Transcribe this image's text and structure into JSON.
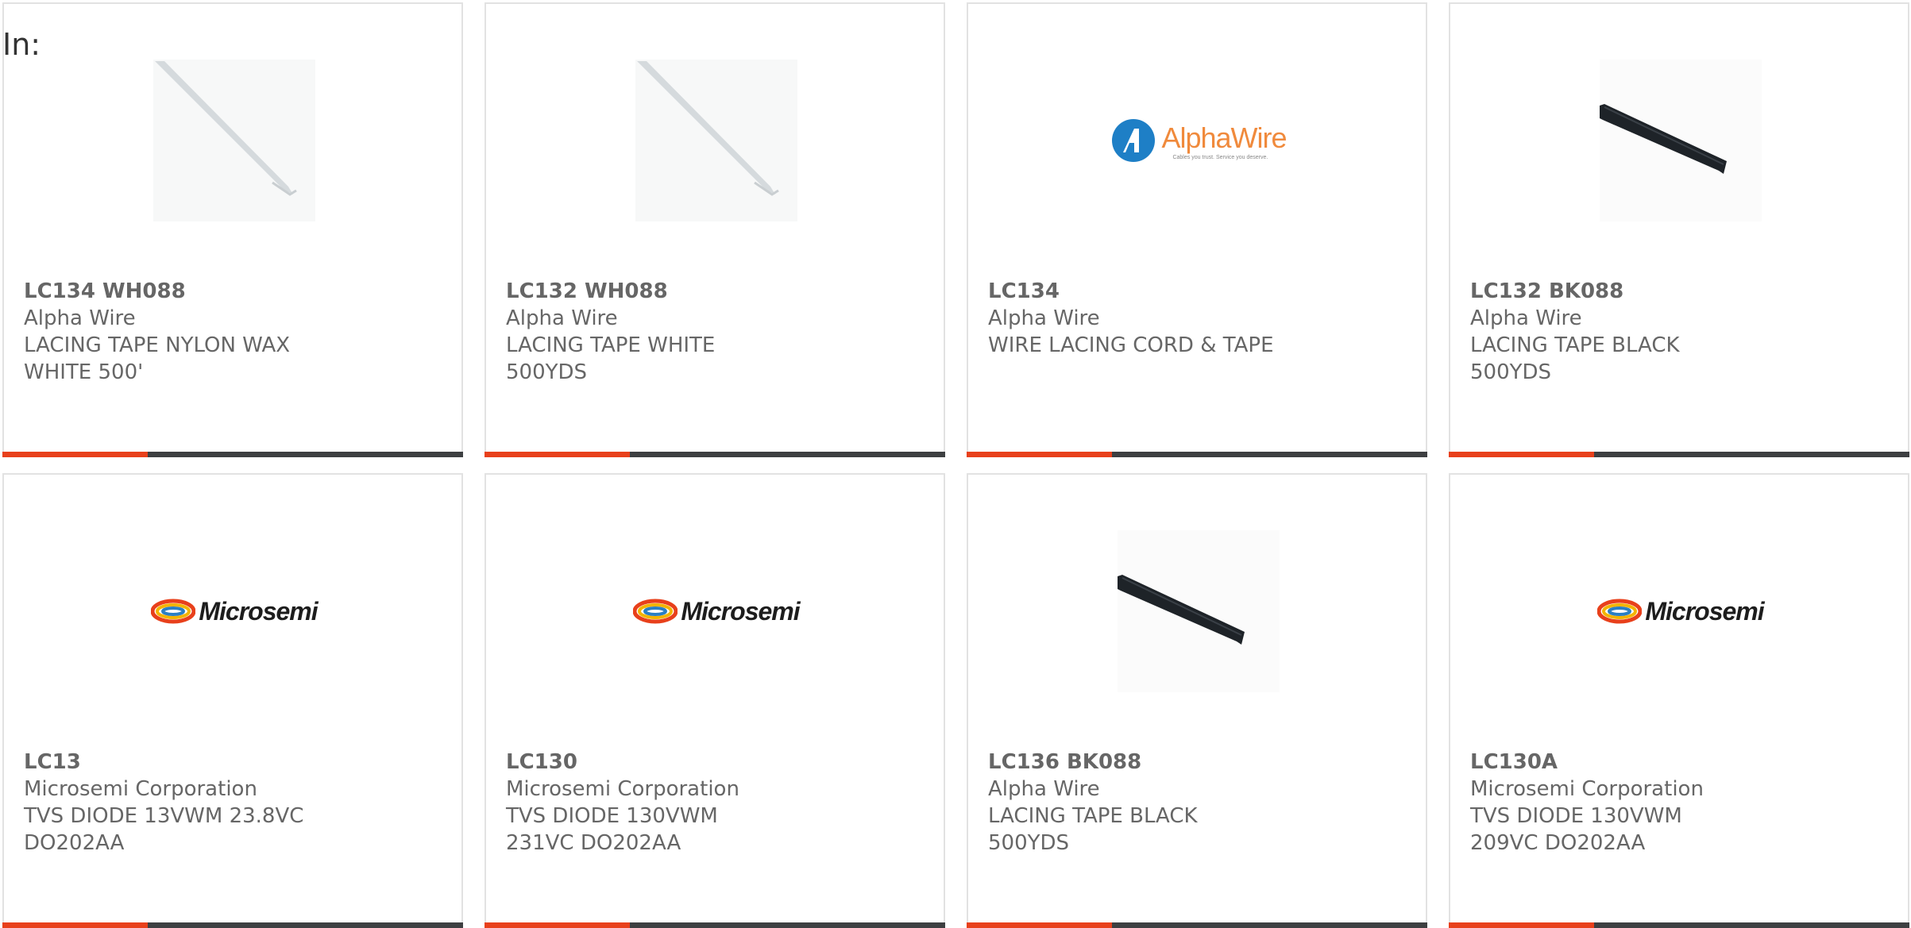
{
  "page": {
    "filter_label": "In:"
  },
  "colors": {
    "accent": "#e8401b",
    "bar_dark": "#3d3f41",
    "text": "#666666",
    "alphawire_orange": "#f08a3c",
    "alphawire_blue": "#1e7fc6"
  },
  "products": [
    {
      "part_number": "LC134 WH088",
      "manufacturer": "Alpha Wire",
      "description": "LACING TAPE NYLON WAX WHITE 500'",
      "image": "white-lacing-tape-photo"
    },
    {
      "part_number": "LC132 WH088",
      "manufacturer": "Alpha Wire",
      "description": "LACING TAPE WHITE 500YDS",
      "image": "white-lacing-tape-photo"
    },
    {
      "part_number": "LC134",
      "manufacturer": "Alpha Wire",
      "description": "WIRE LACING CORD & TAPE",
      "image": "alphawire-logo",
      "logo_text": "AlphaWire",
      "logo_tagline": "Cables you trust. Service you deserve."
    },
    {
      "part_number": "LC132 BK088",
      "manufacturer": "Alpha Wire",
      "description": "LACING TAPE BLACK 500YDS",
      "image": "black-lacing-tape-photo"
    },
    {
      "part_number": "LC13",
      "manufacturer": "Microsemi Corporation",
      "description": "TVS DIODE 13VWM 23.8VC DO202AA",
      "image": "microsemi-logo",
      "logo_text": "Microsemi"
    },
    {
      "part_number": "LC130",
      "manufacturer": "Microsemi Corporation",
      "description": "TVS DIODE 130VWM 231VC DO202AA",
      "image": "microsemi-logo",
      "logo_text": "Microsemi"
    },
    {
      "part_number": "LC136 BK088",
      "manufacturer": "Alpha Wire",
      "description": "LACING TAPE BLACK 500YDS",
      "image": "black-lacing-tape-photo"
    },
    {
      "part_number": "LC130A",
      "manufacturer": "Microsemi Corporation",
      "description": "TVS DIODE 130VWM 209VC DO202AA",
      "image": "microsemi-logo",
      "logo_text": "Microsemi"
    }
  ]
}
